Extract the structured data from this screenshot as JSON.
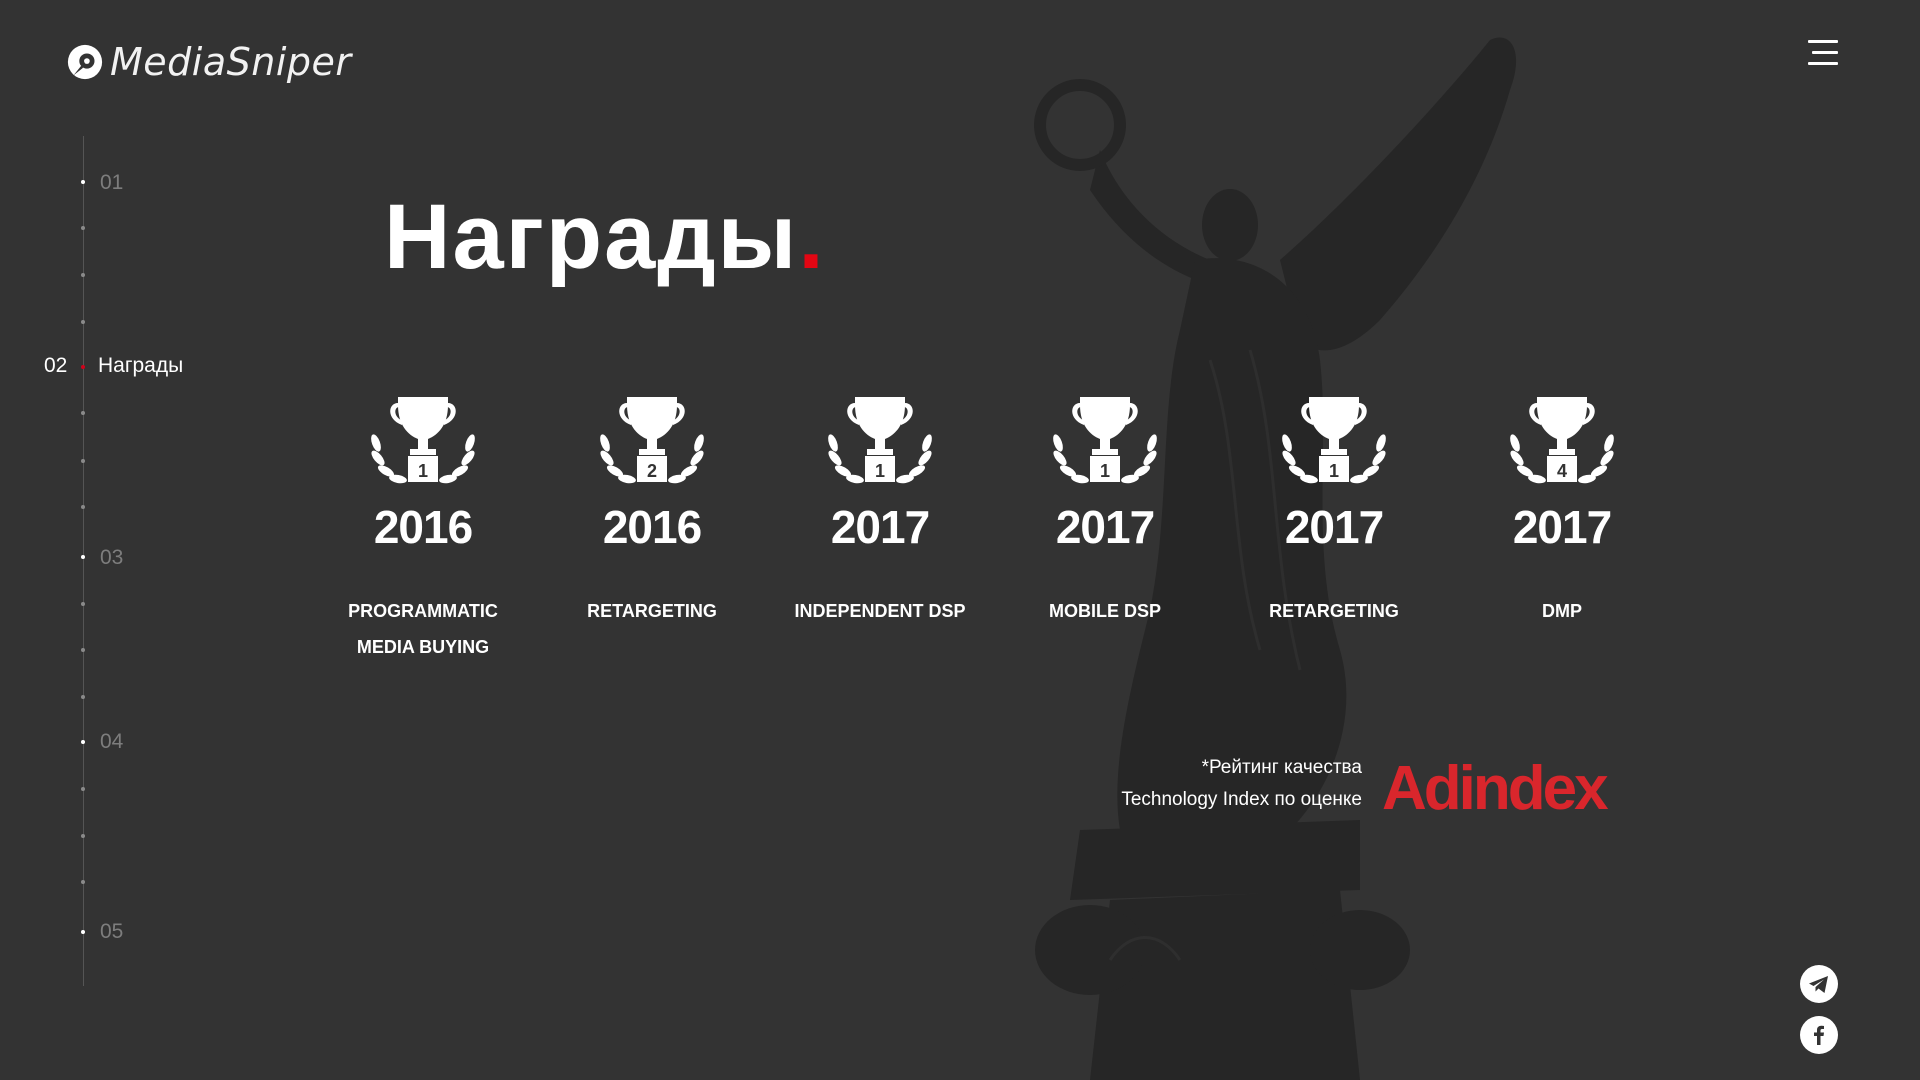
{
  "brand": {
    "name": "MediaSniper",
    "logo_icon": "sniper-scope-icon"
  },
  "header": {
    "menu_icon": "hamburger-menu-icon"
  },
  "sidebar": {
    "active": {
      "number": "02",
      "label": "Награды"
    },
    "items": [
      {
        "number": "01"
      },
      {
        "number": "03"
      },
      {
        "number": "04"
      },
      {
        "number": "05"
      }
    ]
  },
  "page": {
    "title": "Награды",
    "title_dot": "."
  },
  "awards": [
    {
      "place": "1",
      "year": "2016",
      "line1": "PROGRAMMATIC",
      "line2": "MEDIA BUYING"
    },
    {
      "place": "2",
      "year": "2016",
      "line1": "RETARGETING",
      "line2": ""
    },
    {
      "place": "1",
      "year": "2017",
      "line1": "INDEPENDENT DSP",
      "line2": ""
    },
    {
      "place": "1",
      "year": "2017",
      "line1": "MOBILE DSP",
      "line2": ""
    },
    {
      "place": "1",
      "year": "2017",
      "line1": "RETARGETING",
      "line2": ""
    },
    {
      "place": "4",
      "year": "2017",
      "line1": "DMP",
      "line2": ""
    }
  ],
  "rating": {
    "line1": "*Рейтинг качества",
    "line2": "Technology Index по оценке",
    "source": "Adindex"
  },
  "social": {
    "telegram": "telegram-icon",
    "facebook": "facebook-icon"
  },
  "colors": {
    "background": "#333333",
    "accent": "#e30613",
    "adindex": "#d9262c",
    "text": "#ffffff"
  }
}
